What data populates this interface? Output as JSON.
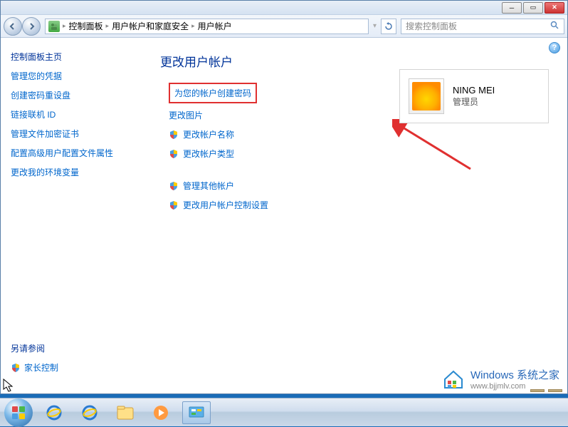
{
  "breadcrumb": {
    "items": [
      "控制面板",
      "用户帐户和家庭安全",
      "用户帐户"
    ]
  },
  "search": {
    "placeholder": "搜索控制面板"
  },
  "sidebar": {
    "title": "控制面板主页",
    "links": [
      "管理您的凭据",
      "创建密码重设盘",
      "链接联机 ID",
      "管理文件加密证书",
      "配置高级用户配置文件属性",
      "更改我的环境变量"
    ],
    "see_also_title": "另请参阅",
    "see_also": [
      "家长控制"
    ]
  },
  "main": {
    "title": "更改用户帐户",
    "actions": [
      {
        "label": "为您的帐户创建密码",
        "shield": false,
        "highlighted": true
      },
      {
        "label": "更改图片",
        "shield": false,
        "highlighted": false
      },
      {
        "label": "更改帐户名称",
        "shield": true,
        "highlighted": false
      },
      {
        "label": "更改帐户类型",
        "shield": true,
        "highlighted": false
      }
    ],
    "actions2": [
      {
        "label": "管理其他帐户",
        "shield": true
      },
      {
        "label": "更改用户帐户控制设置",
        "shield": true
      }
    ]
  },
  "account": {
    "name": "NING MEI",
    "role": "管理员"
  },
  "watermark": {
    "title": "Windows 系统之家",
    "sub": "www.bjjmlv.com"
  }
}
